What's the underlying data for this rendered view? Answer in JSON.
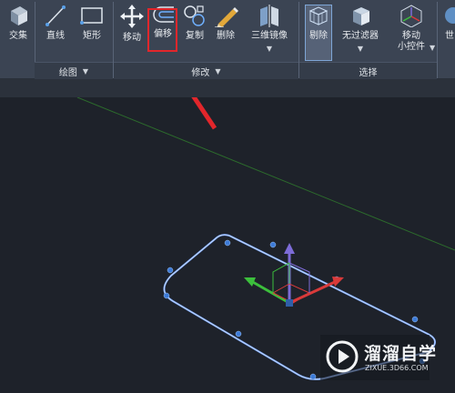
{
  "ribbon": {
    "draw_panel": {
      "title": "绘图",
      "tools": {
        "intersect": "交集",
        "line": "直线",
        "rectangle": "矩形"
      }
    },
    "modify_panel": {
      "title": "修改",
      "tools": {
        "move": "移动",
        "offset": "偏移",
        "copy": "复制",
        "erase": "删除",
        "mirror3d": "三维镜像"
      }
    },
    "select_panel": {
      "title": "选择",
      "tools": {
        "cull": "剔除",
        "no_filter": "无过滤器",
        "move_gizmo_line1": "移动",
        "move_gizmo_line2": "小控件"
      }
    },
    "partial_tool": "世"
  },
  "watermark": {
    "brand": "溜溜自学",
    "url": "ZIXUE.3D66.COM"
  },
  "colors": {
    "ribbon_bg": "#3b4453",
    "viewport_bg": "#1e222a",
    "highlight_border": "#e2262b",
    "arrow": "#e2262b",
    "selection": "#7aa8ff",
    "grip": "#3d7bd8",
    "gizmo_x": "#d93a3a",
    "gizmo_y": "#3cbf3c",
    "gizmo_z": "#7d6cd8"
  }
}
